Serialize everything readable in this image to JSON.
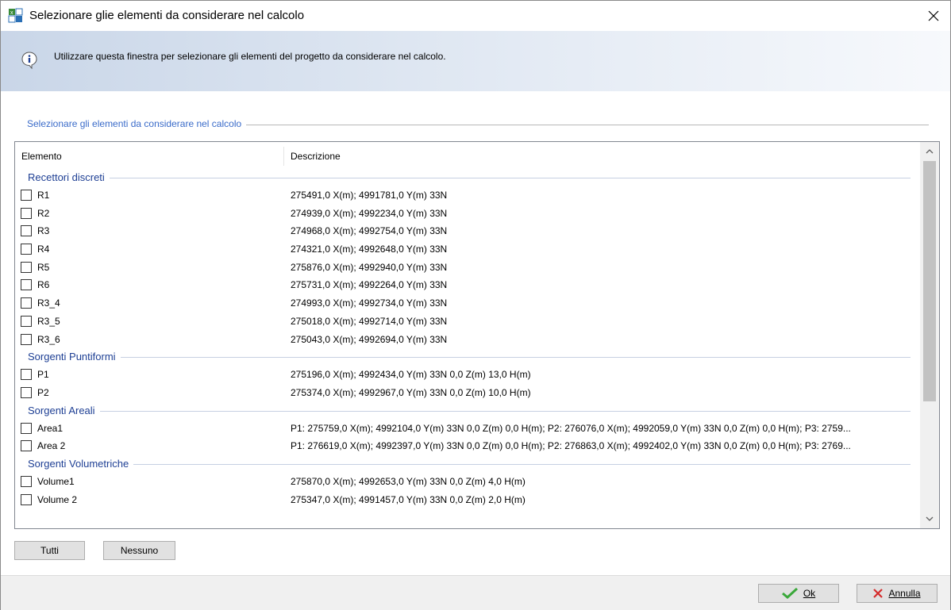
{
  "window": {
    "title": "Selezionare glie elementi da considerare nel calcolo",
    "icon": "app-table-icon",
    "close_icon": "close-icon"
  },
  "banner": {
    "icon": "info-icon",
    "text": "Utilizzare questa finestra per selezionare gli elementi del progetto da considerare nel calcolo."
  },
  "group": {
    "label": "Selezionare gli elementi da considerare nel calcolo"
  },
  "list": {
    "columns": [
      "Elemento",
      "Descrizione"
    ],
    "groups": [
      {
        "label": "Recettori discreti",
        "items": [
          {
            "name": "R1",
            "desc": "275491,0 X(m); 4991781,0 Y(m) 33N",
            "checked": false
          },
          {
            "name": "R2",
            "desc": "274939,0 X(m); 4992234,0 Y(m) 33N",
            "checked": false
          },
          {
            "name": "R3",
            "desc": "274968,0 X(m); 4992754,0 Y(m) 33N",
            "checked": false
          },
          {
            "name": "R4",
            "desc": "274321,0 X(m); 4992648,0 Y(m) 33N",
            "checked": false
          },
          {
            "name": "R5",
            "desc": "275876,0 X(m); 4992940,0 Y(m) 33N",
            "checked": false
          },
          {
            "name": "R6",
            "desc": "275731,0 X(m); 4992264,0 Y(m) 33N",
            "checked": false
          },
          {
            "name": "R3_4",
            "desc": "274993,0 X(m); 4992734,0 Y(m) 33N",
            "checked": false
          },
          {
            "name": "R3_5",
            "desc": "275018,0 X(m); 4992714,0 Y(m) 33N",
            "checked": false
          },
          {
            "name": "R3_6",
            "desc": "275043,0 X(m); 4992694,0 Y(m) 33N",
            "checked": false
          }
        ]
      },
      {
        "label": "Sorgenti Puntiformi",
        "items": [
          {
            "name": "P1",
            "desc": "275196,0 X(m); 4992434,0 Y(m) 33N  0,0 Z(m) 13,0 H(m)",
            "checked": false
          },
          {
            "name": "P2",
            "desc": "275374,0 X(m); 4992967,0 Y(m) 33N  0,0 Z(m) 10,0 H(m)",
            "checked": false
          }
        ]
      },
      {
        "label": "Sorgenti Areali",
        "items": [
          {
            "name": "Area1",
            "desc": "P1: 275759,0 X(m); 4992104,0 Y(m) 33N  0,0 Z(m) 0,0 H(m); P2: 276076,0 X(m); 4992059,0 Y(m) 33N  0,0 Z(m) 0,0 H(m); P3: 2759...",
            "checked": false
          },
          {
            "name": "Area 2",
            "desc": "P1: 276619,0 X(m); 4992397,0 Y(m) 33N  0,0 Z(m) 0,0 H(m); P2: 276863,0 X(m); 4992402,0 Y(m) 33N  0,0 Z(m) 0,0 H(m); P3: 2769...",
            "checked": false
          }
        ]
      },
      {
        "label": "Sorgenti Volumetriche",
        "items": [
          {
            "name": "Volume1",
            "desc": "275870,0 X(m); 4992653,0 Y(m) 33N  0,0 Z(m) 4,0 H(m)",
            "checked": false
          },
          {
            "name": "Volume 2",
            "desc": "275347,0 X(m); 4991457,0 Y(m) 33N  0,0 Z(m) 2,0 H(m)",
            "checked": false
          }
        ]
      }
    ]
  },
  "buttons": {
    "all": "Tutti",
    "none": "Nessuno",
    "ok": "Ok",
    "cancel": "Annulla"
  },
  "colors": {
    "accent": "#3a6bc9",
    "group_label": "#1e3f94",
    "ok_icon": "#3aa83a",
    "cancel_icon": "#d42b2b"
  }
}
